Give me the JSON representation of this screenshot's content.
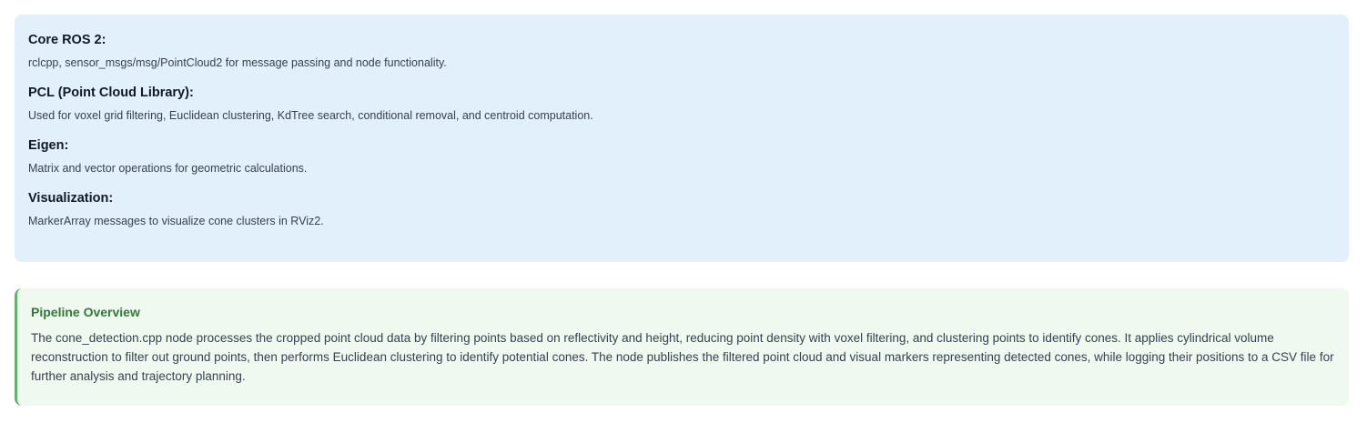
{
  "dependencies": [
    {
      "title": "Core ROS 2:",
      "description": "rclcpp, sensor_msgs/msg/PointCloud2 for message passing and node functionality."
    },
    {
      "title": "PCL (Point Cloud Library):",
      "description": "Used for voxel grid filtering, Euclidean clustering, KdTree search, conditional removal, and centroid computation."
    },
    {
      "title": "Eigen:",
      "description": "Matrix and vector operations for geometric calculations."
    },
    {
      "title": "Visualization:",
      "description": "MarkerArray messages to visualize cone clusters in RViz2."
    }
  ],
  "pipeline": {
    "title": "Pipeline Overview",
    "text": "The cone_detection.cpp node processes the cropped point cloud data by filtering points based on reflectivity and height, reducing point density with voxel filtering, and clustering points to identify cones. It applies cylindrical volume reconstruction to filter out ground points, then performs Euclidean clustering to identify potential cones. The node publishes the filtered point cloud and visual markers representing detected cones, while logging their positions to a CSV file for further analysis and trajectory planning."
  },
  "colors": {
    "dependencies_background": "#e1f0fb",
    "pipeline_background": "#eff9ef",
    "pipeline_accent": "#5fb36a",
    "pipeline_title": "#2f7a3a"
  }
}
